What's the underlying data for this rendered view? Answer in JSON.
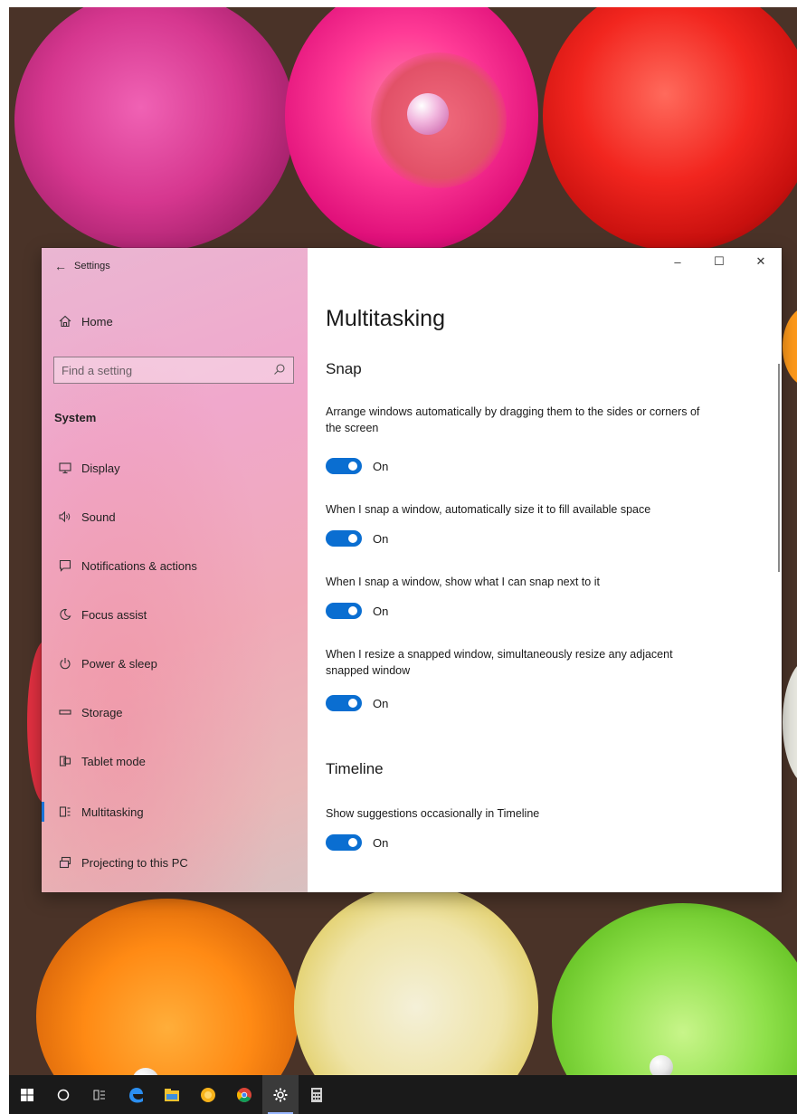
{
  "window": {
    "title": "Settings"
  },
  "window_controls": {
    "minimize": "–",
    "maximize": "☐",
    "close": "✕"
  },
  "sidebar": {
    "home_label": "Home",
    "search": {
      "placeholder": "Find a setting"
    },
    "section_label": "System",
    "items": [
      {
        "label": "Display",
        "icon": "display-icon"
      },
      {
        "label": "Sound",
        "icon": "sound-icon"
      },
      {
        "label": "Notifications & actions",
        "icon": "notifications-icon"
      },
      {
        "label": "Focus assist",
        "icon": "focus-assist-icon"
      },
      {
        "label": "Power & sleep",
        "icon": "power-icon"
      },
      {
        "label": "Storage",
        "icon": "storage-icon"
      },
      {
        "label": "Tablet mode",
        "icon": "tablet-mode-icon"
      },
      {
        "label": "Multitasking",
        "icon": "multitasking-icon",
        "selected": true
      },
      {
        "label": "Projecting to this PC",
        "icon": "projecting-icon"
      }
    ]
  },
  "main": {
    "title": "Multitasking",
    "snap": {
      "heading": "Snap",
      "settings": [
        {
          "description": "Arrange windows automatically by dragging them to the sides or corners of the screen",
          "state": "On"
        },
        {
          "description": "When I snap a window, automatically size it to fill available space",
          "state": "On"
        },
        {
          "description": "When I snap a window, show what I can snap next to it",
          "state": "On"
        },
        {
          "description": "When I resize a snapped window, simultaneously resize any adjacent snapped window",
          "state": "On"
        }
      ]
    },
    "timeline": {
      "heading": "Timeline",
      "settings": [
        {
          "description": "Show suggestions occasionally in Timeline",
          "state": "On"
        }
      ]
    }
  },
  "colors": {
    "accent": "#0a6ed1",
    "taskbar": "#1a1a1a",
    "active_nav_bar": "#1a73d9"
  },
  "taskbar": {
    "icons": [
      "start-icon",
      "cortana-search-icon",
      "task-view-icon",
      "edge-icon",
      "file-explorer-icon",
      "sticky-app-icon",
      "chrome-icon",
      "settings-icon",
      "calculator-icon"
    ]
  }
}
